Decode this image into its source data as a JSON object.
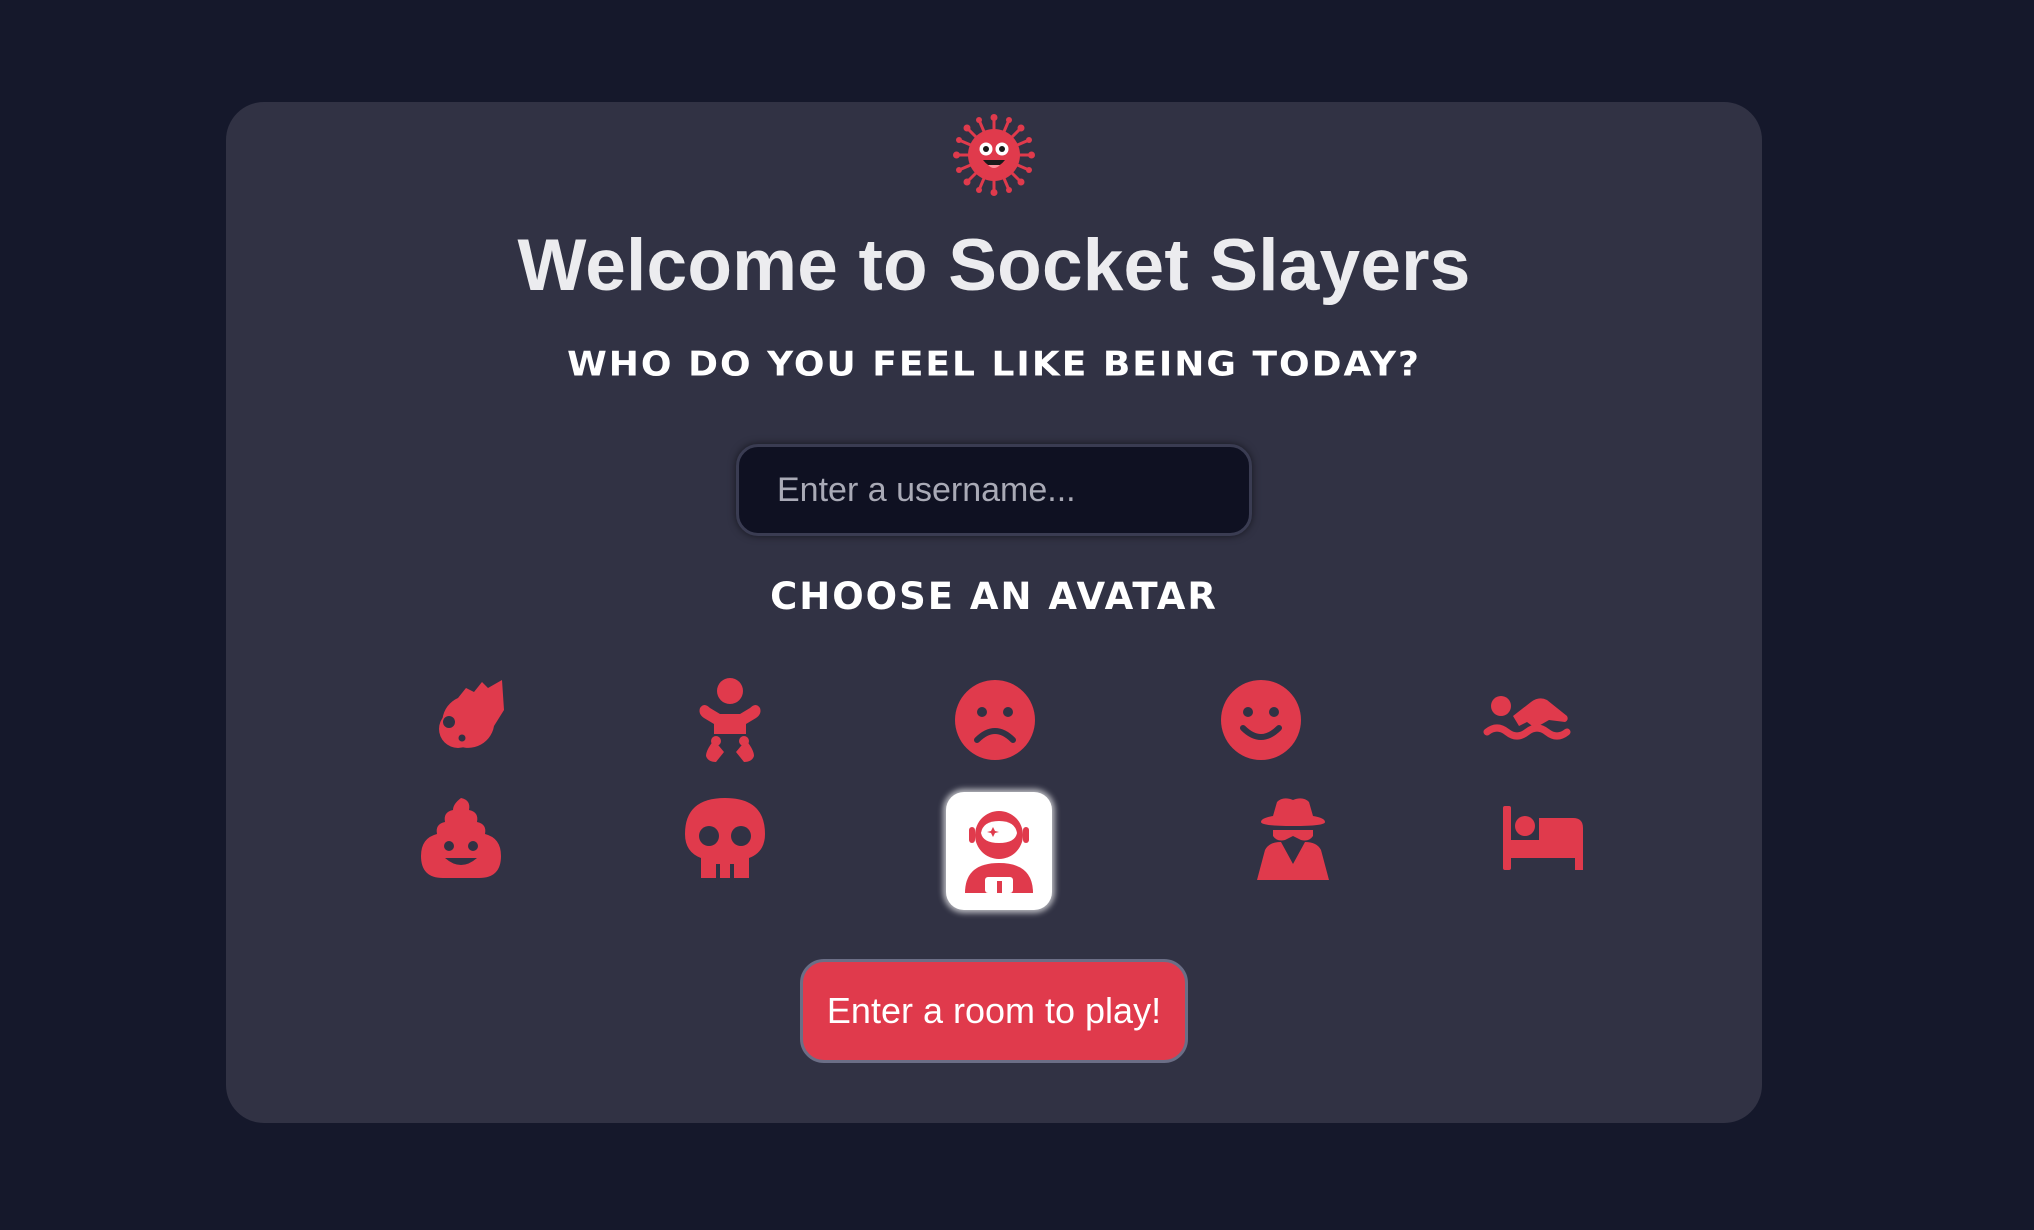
{
  "app": {
    "title": "Welcome to Socket Slayers",
    "logo_icon": "virus-icon",
    "accent_color": "#e03a4c"
  },
  "form": {
    "subtitle": "WHO DO YOU FEEL LIKE BEING TODAY?",
    "username_value": "",
    "username_placeholder": "Enter a username...",
    "avatar_heading": "CHOOSE AN AVATAR",
    "submit_label": "Enter a room to play!"
  },
  "avatars": [
    {
      "icon": "meteor-icon",
      "selected": false
    },
    {
      "icon": "baby-icon",
      "selected": false
    },
    {
      "icon": "sad-face-icon",
      "selected": false
    },
    {
      "icon": "smile-face-icon",
      "selected": false
    },
    {
      "icon": "swimmer-icon",
      "selected": false
    },
    {
      "icon": "poop-icon",
      "selected": false
    },
    {
      "icon": "skull-icon",
      "selected": false
    },
    {
      "icon": "astronaut-icon",
      "selected": true
    },
    {
      "icon": "spy-icon",
      "selected": false
    },
    {
      "icon": "bed-icon",
      "selected": false
    }
  ]
}
